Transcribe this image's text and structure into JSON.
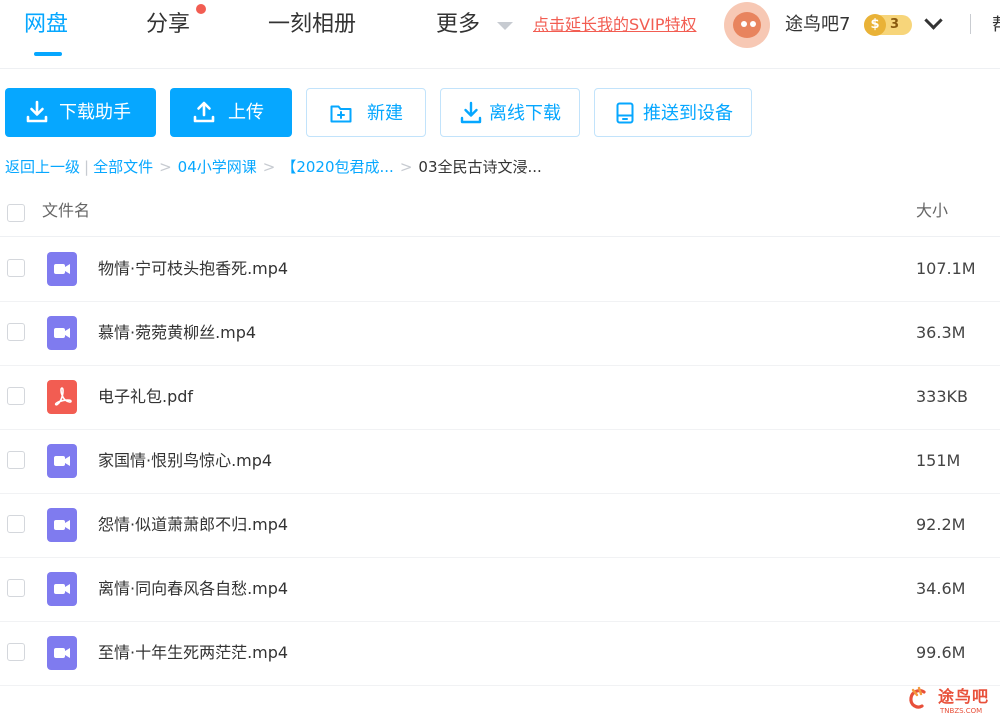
{
  "nav": {
    "tabs": [
      {
        "label": "网盘",
        "active": true
      },
      {
        "label": "分享",
        "active": false,
        "has_dot": true
      },
      {
        "label": "一刻相册",
        "active": false
      },
      {
        "label": "更多",
        "active": false
      }
    ],
    "promo_link": "点击延长我的SVIP特权",
    "username": "途鸟吧7",
    "coin_symbol": "$",
    "coin_level": "3",
    "cutoff_text": "帮"
  },
  "toolbar": {
    "buttons": [
      {
        "label": "下载助手",
        "style": "primary",
        "icon": "download-icon"
      },
      {
        "label": "上传",
        "style": "primary",
        "icon": "upload-icon"
      },
      {
        "label": "新建",
        "style": "outline",
        "icon": "new-folder-icon"
      },
      {
        "label": "离线下载",
        "style": "outline",
        "icon": "offline-download-icon"
      },
      {
        "label": "推送到设备",
        "style": "outline",
        "icon": "device-icon"
      }
    ]
  },
  "breadcrumb": {
    "back": "返回上一级",
    "items": [
      "全部文件",
      "04小学网课",
      "【2020包君成..."
    ],
    "current": "03全民古诗文浸..."
  },
  "list": {
    "header_name": "文件名",
    "header_size": "大小",
    "files": [
      {
        "name": "物情·宁可枝头抱香死.mp4",
        "size": "107.1M",
        "type": "video"
      },
      {
        "name": "慕情·菀菀黄柳丝.mp4",
        "size": "36.3M",
        "type": "video"
      },
      {
        "name": "电子礼包.pdf",
        "size": "333KB",
        "type": "pdf"
      },
      {
        "name": "家国情·恨别鸟惊心.mp4",
        "size": "151M",
        "type": "video"
      },
      {
        "name": "怨情·似道萧萧郎不归.mp4",
        "size": "92.2M",
        "type": "video"
      },
      {
        "name": "离情·同向春风各自愁.mp4",
        "size": "34.6M",
        "type": "video"
      },
      {
        "name": "至情·十年生死两茫茫.mp4",
        "size": "99.6M",
        "type": "video"
      }
    ]
  },
  "watermark": {
    "text": "途鸟吧",
    "sub": "TNBZS.COM"
  },
  "colors": {
    "accent": "#06a7ff",
    "promo": "#f25d52",
    "video_icon": "#7f7bef",
    "pdf_icon": "#f25d52"
  }
}
